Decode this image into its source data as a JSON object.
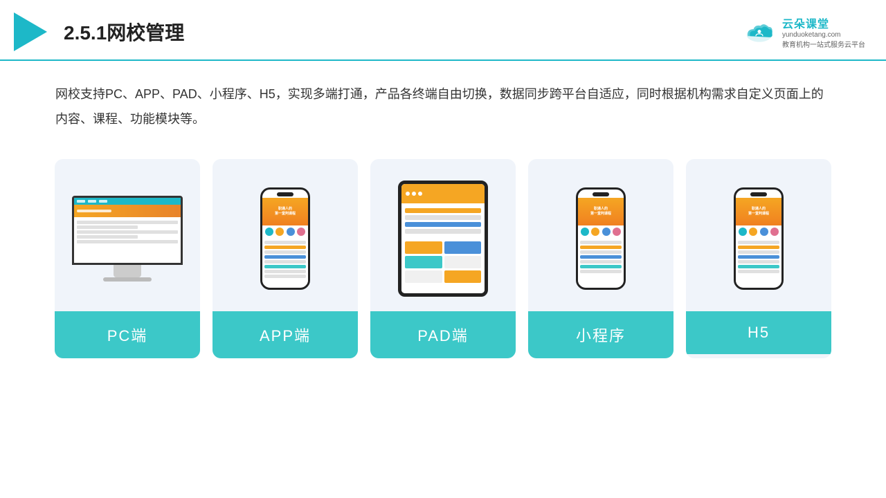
{
  "header": {
    "title": "2.5.1网校管理",
    "logo": {
      "name": "云朵课堂",
      "url": "yunduoketang.com",
      "subtitle": "教育机构一站式服务云平台"
    }
  },
  "description": {
    "text": "网校支持PC、APP、PAD、小程序、H5，实现多端打通，产品各终端自由切换，数据同步跨平台自适应，同时根据机构需求自定义页面上的内容、课程、功能模块等。"
  },
  "cards": [
    {
      "id": "pc",
      "label": "PC端"
    },
    {
      "id": "app",
      "label": "APP端"
    },
    {
      "id": "pad",
      "label": "PAD端"
    },
    {
      "id": "miniprogram",
      "label": "小程序"
    },
    {
      "id": "h5",
      "label": "H5"
    }
  ],
  "colors": {
    "accent": "#1db8c8",
    "orange": "#f5a623",
    "card_bg": "#eef2f8",
    "label_bg": "#3cc8c8"
  }
}
